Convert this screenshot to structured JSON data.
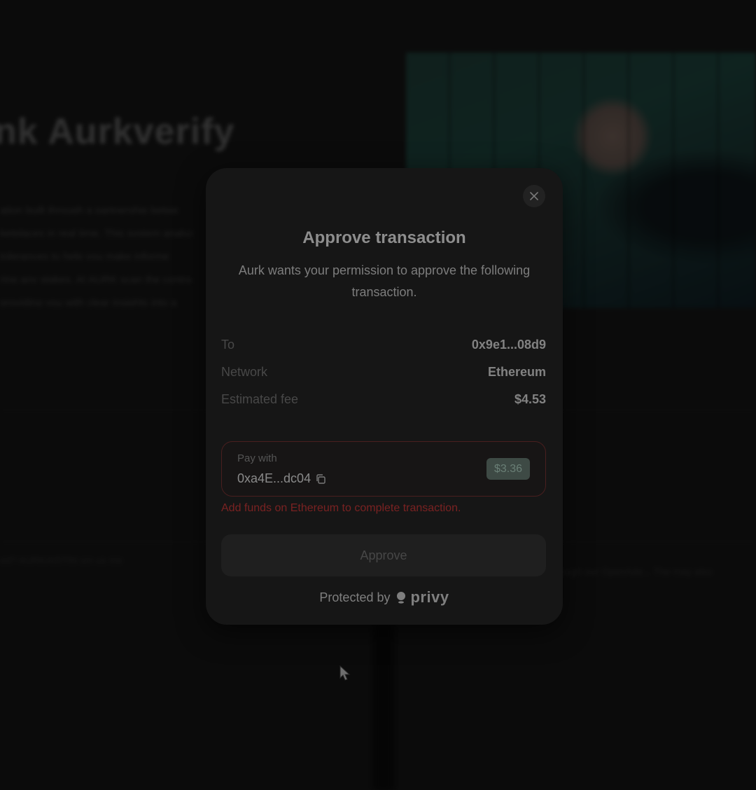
{
  "background": {
    "heading": "nk Aurkverify",
    "paragraph_lines": [
      "ation built through a partnership betwe",
      "ketplaces in real time. This system analyz",
      "tolerances to help you make informe",
      "ring any stakes, AI AURK scan the contra",
      "providing you with clear insights into a"
    ],
    "caption_left": "ed? AURKAISTIN sm us me",
    "caption_right": "ough our OpenAde... The may also"
  },
  "modal": {
    "title": "Approve transaction",
    "subtitle": "Aurk wants your permission to approve the following transaction.",
    "details": [
      {
        "label": "To",
        "value": "0x9e1...08d9"
      },
      {
        "label": "Network",
        "value": "Ethereum"
      },
      {
        "label": "Estimated fee",
        "value": "$4.53"
      }
    ],
    "pay_with": {
      "label": "Pay with",
      "address": "0xa4E...dc04",
      "balance": "$3.36"
    },
    "error": "Add funds on Ethereum to complete transaction.",
    "approve_label": "Approve",
    "footer": {
      "protected_by": "Protected by",
      "brand": "privy"
    }
  },
  "icons": {
    "close": "close-icon",
    "copy": "copy-icon",
    "brand": "privy-logo-icon",
    "cursor": "mouse-cursor-icon"
  },
  "colors": {
    "error": "#7a2222",
    "badge_bg": "#3e4a45",
    "modal_bg": "#161616"
  }
}
